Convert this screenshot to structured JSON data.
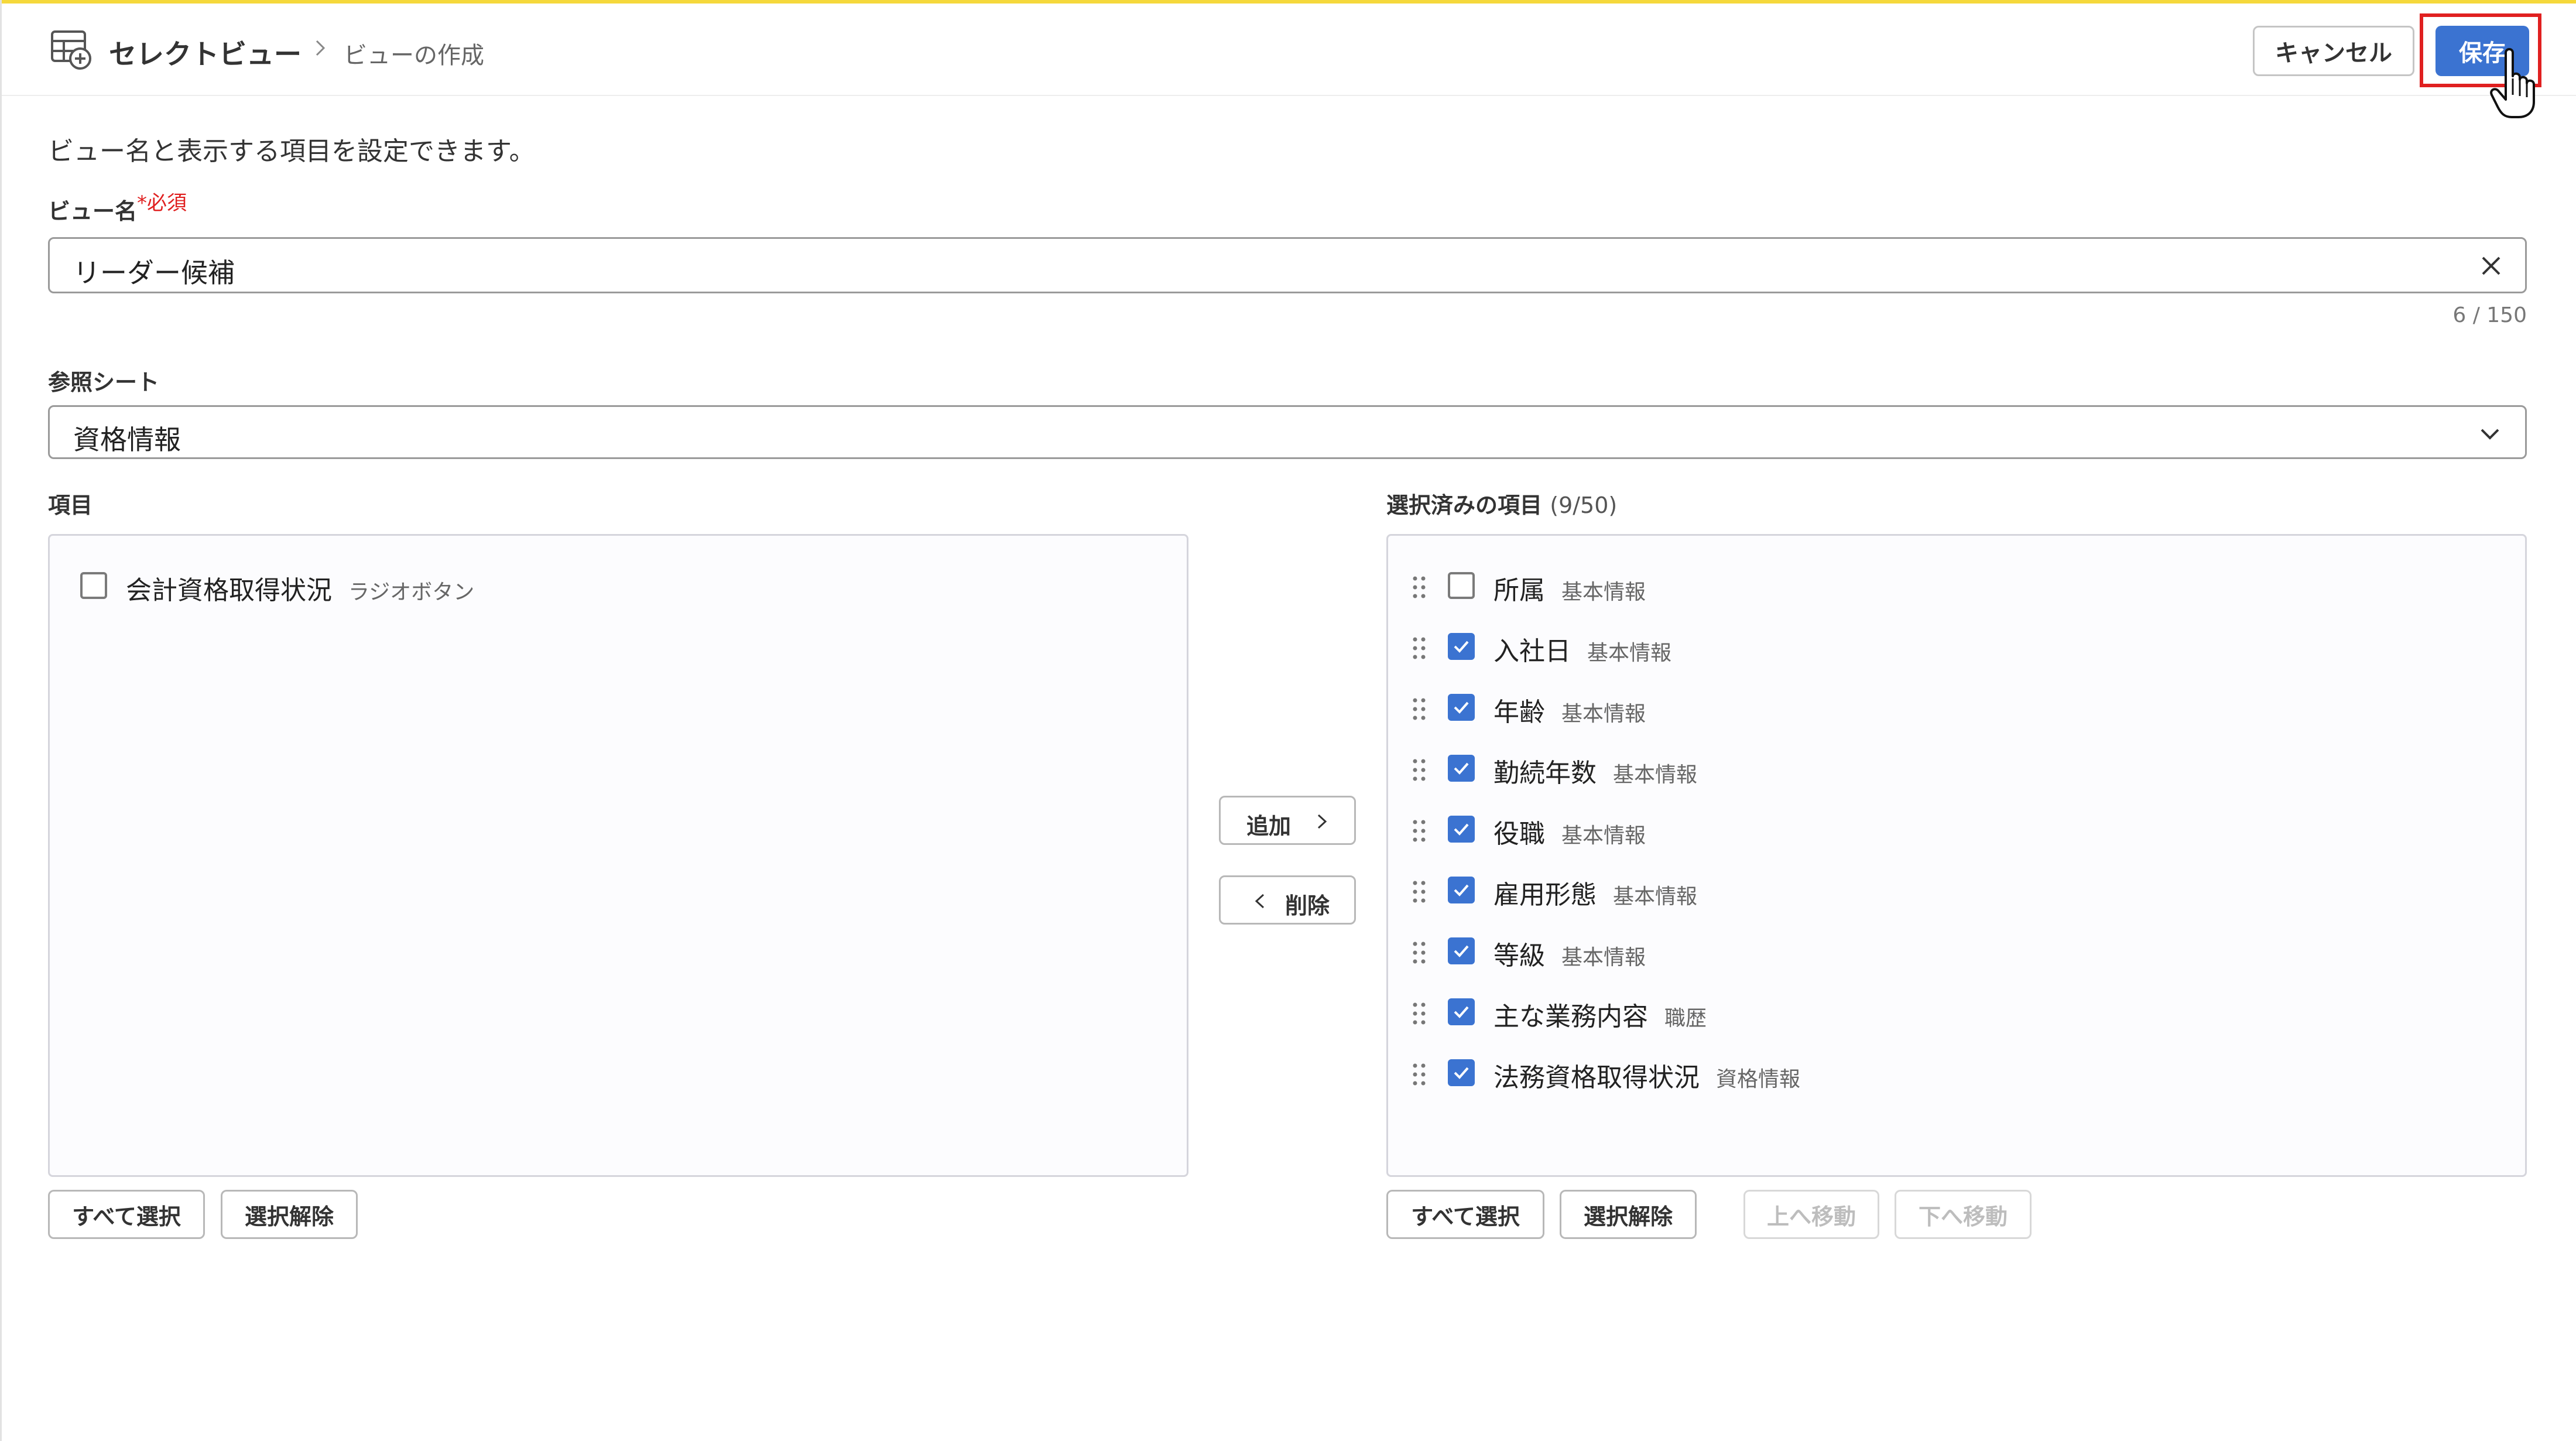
{
  "header": {
    "app_title": "セレクトビュー",
    "current_page": "ビューの作成",
    "cancel_label": "キャンセル",
    "save_label": "保存"
  },
  "description": "ビュー名と表示する項目を設定できます。",
  "view_name": {
    "label": "ビュー名",
    "required_mark": "*必須",
    "value": "リーダー候補",
    "char_count": "6 / 150"
  },
  "reference_sheet": {
    "label": "参照シート",
    "selected": "資格情報"
  },
  "available": {
    "label": "項目",
    "items": [
      {
        "name": "会計資格取得状況",
        "type": "ラジオボタン",
        "checked": false
      }
    ],
    "select_all_label": "すべて選択",
    "deselect_label": "選択解除"
  },
  "transfer": {
    "add_label": "追加",
    "remove_label": "削除"
  },
  "selected": {
    "label": "選択済みの項目",
    "count": "(9/50)",
    "items": [
      {
        "name": "所属",
        "sheet": "基本情報",
        "checked": false
      },
      {
        "name": "入社日",
        "sheet": "基本情報",
        "checked": true
      },
      {
        "name": "年齢",
        "sheet": "基本情報",
        "checked": true
      },
      {
        "name": "勤続年数",
        "sheet": "基本情報",
        "checked": true
      },
      {
        "name": "役職",
        "sheet": "基本情報",
        "checked": true
      },
      {
        "name": "雇用形態",
        "sheet": "基本情報",
        "checked": true
      },
      {
        "name": "等級",
        "sheet": "基本情報",
        "checked": true
      },
      {
        "name": "主な業務内容",
        "sheet": "職歴",
        "checked": true
      },
      {
        "name": "法務資格取得状況",
        "sheet": "資格情報",
        "checked": true
      }
    ],
    "select_all_label": "すべて選択",
    "deselect_label": "選択解除",
    "move_up_label": "上へ移動",
    "move_down_label": "下へ移動"
  },
  "colors": {
    "accent": "#3b73d1",
    "highlight": "#e02020",
    "top_bar": "#f5d83b"
  }
}
